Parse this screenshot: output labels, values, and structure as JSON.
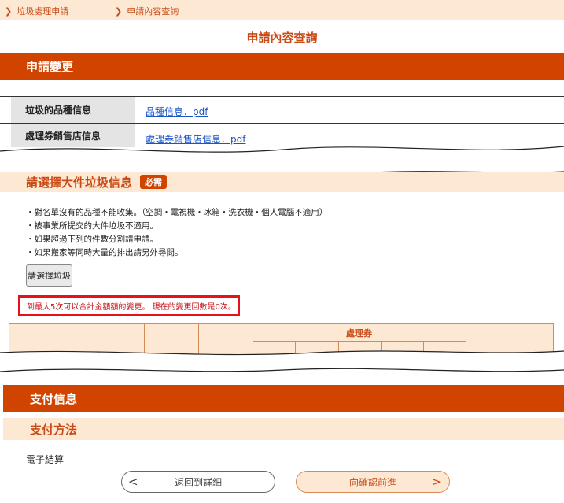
{
  "breadcrumb": {
    "items": [
      {
        "chevron": "❯",
        "label": "垃圾處理申請"
      },
      {
        "chevron": "❯",
        "label": "申請內容查詢"
      }
    ]
  },
  "page_title": "申請內容查詢",
  "change_section": {
    "title": "申請變更",
    "rows": [
      {
        "label": "垃圾的品種信息",
        "link": "品種信息．pdf"
      },
      {
        "label": "處理券銷售店信息",
        "link": "處理券銷售店信息．pdf"
      }
    ]
  },
  "select_section": {
    "title": "請選擇大件垃圾信息",
    "required_badge": "必需",
    "notes": [
      "・對名單沒有的品種不能收集。（空調・電視機・冰箱・洗衣機・個人電腦不適用）",
      "・被事業所提交的大件垃圾不適用。",
      "・如果超過下列的件數分割請申請。",
      "・如果搬家等同時大量的排出請另外尋問。"
    ],
    "select_button": "請選擇垃圾",
    "notice": "到最大5次可以合計金額額的變更。 現在的變更回數是0次。",
    "table_header_group": "處理券"
  },
  "payment": {
    "title": "支付信息",
    "method_title": "支付方法",
    "method_value": "電子結算"
  },
  "footer": {
    "back_label": "返回到詳細",
    "forward_label": "向確認前進",
    "back_arrow": "<",
    "forward_arrow": ">"
  },
  "colors": {
    "accent": "#d14400",
    "accent_text": "#c84b17",
    "peach": "#fde9d3",
    "notice_border": "#e8101a",
    "link": "#1a55c8"
  }
}
